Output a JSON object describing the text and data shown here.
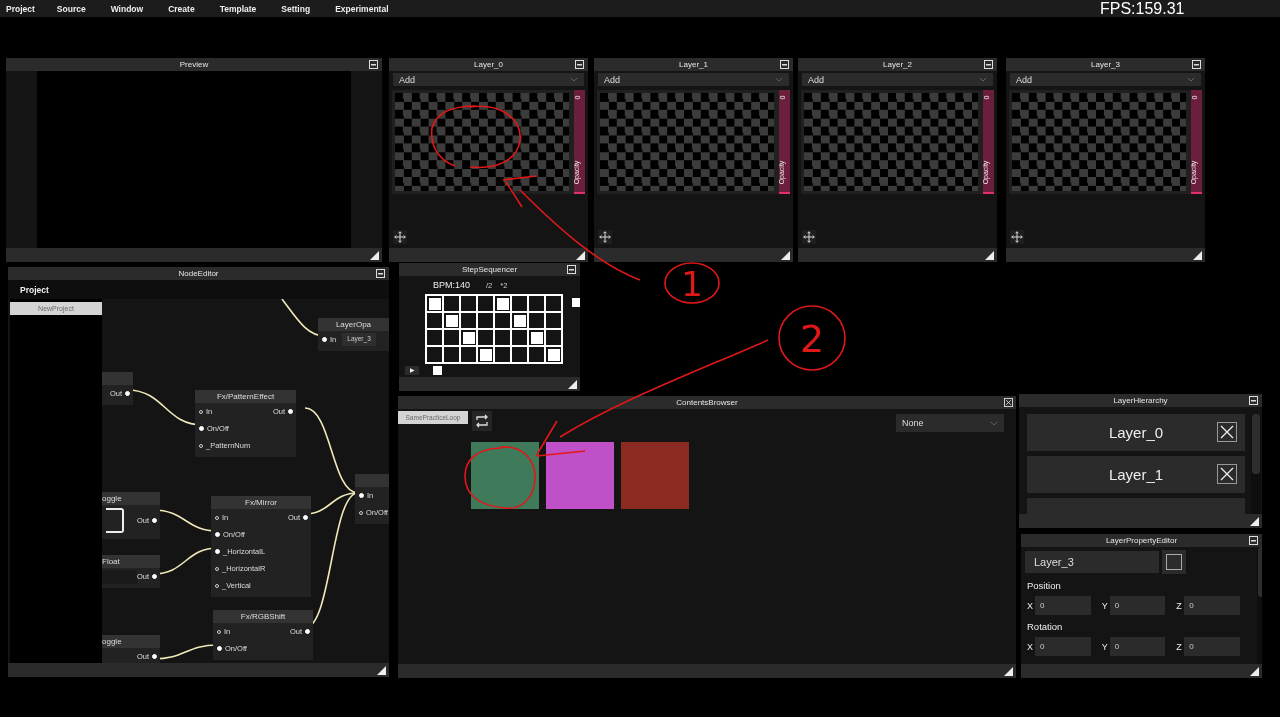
{
  "menu": [
    "Project",
    "Source",
    "Window",
    "Create",
    "Template",
    "Setting",
    "Experimental"
  ],
  "fps": "FPS:159.31",
  "preview": {
    "title": "Preview"
  },
  "layers": [
    {
      "title": "Layer_0",
      "blend": "Add",
      "opacity_value": "0",
      "opacity_label": "Opacity",
      "level": 0
    },
    {
      "title": "Layer_1",
      "blend": "Add",
      "opacity_value": "0",
      "opacity_label": "Opacity",
      "level": 0
    },
    {
      "title": "Layer_2",
      "blend": "Add",
      "opacity_value": "0",
      "opacity_label": "Opacity",
      "level": 0
    },
    {
      "title": "Layer_3",
      "blend": "Add",
      "opacity_value": "0",
      "opacity_label": "Opacity",
      "level": 0
    }
  ],
  "node_editor": {
    "title": "NodeEditor",
    "header": "Project",
    "projects": [
      {
        "label": "NewProject",
        "selected": true
      }
    ],
    "nodes": [
      {
        "rows": [
          {
            "right": {
              "label": "Out",
              "connected": true
            }
          }
        ]
      },
      {
        "title": "LayerOpa",
        "rows": [
          {
            "left": {
              "label": "In",
              "connected": true
            },
            "widget": {
              "kind": "field",
              "value": "Layer_3"
            }
          }
        ]
      },
      {
        "title": "Fx/PatternEffect",
        "rows": [
          {
            "left": {
              "label": "In",
              "connected": false
            },
            "right": {
              "label": "Out",
              "connected": true
            }
          },
          {
            "left": {
              "label": "On/Off",
              "connected": true
            }
          },
          {
            "left": {
              "label": "_PatternNum",
              "connected": false
            }
          }
        ]
      },
      {
        "title": "oggle",
        "rows": [
          {
            "widget": {
              "kind": "toggle",
              "on": false
            },
            "right": {
              "label": "Out",
              "connected": true
            }
          }
        ]
      },
      {
        "title": "Fx/Mirror",
        "rows": [
          {
            "left": {
              "label": "In",
              "connected": false
            },
            "right": {
              "label": "Out",
              "connected": true
            }
          },
          {
            "left": {
              "label": "On/Off",
              "connected": true
            }
          },
          {
            "left": {
              "label": "_HorizontalL",
              "connected": true
            }
          },
          {
            "left": {
              "label": "_HorizontalR",
              "connected": false
            }
          },
          {
            "left": {
              "label": "_Vertical",
              "connected": false
            }
          }
        ]
      },
      {
        "title": "Float",
        "rows": [
          {
            "widget": {
              "kind": "field"
            },
            "right": {
              "label": "Out",
              "connected": true
            }
          }
        ]
      },
      {
        "title": "Fx/RGBShift",
        "rows": [
          {
            "left": {
              "label": "In",
              "connected": false
            },
            "right": {
              "label": "Out",
              "connected": true
            }
          },
          {
            "left": {
              "label": "On/Off",
              "connected": true
            }
          }
        ]
      },
      {
        "title": "oggle",
        "rows": [
          {
            "right": {
              "label": "Out",
              "connected": true
            }
          }
        ]
      },
      {
        "rows": [
          {
            "left": {
              "label": "In",
              "connected": true
            }
          },
          {
            "left": {
              "label": "On/Off",
              "connected": false
            }
          }
        ]
      }
    ]
  },
  "step_sequencer": {
    "title": "StepSequencer",
    "bpm": "BPM:140",
    "half": "/2",
    "double": "*2",
    "play": "▶",
    "steps": [
      [
        true,
        false,
        false,
        false,
        true,
        false,
        false,
        false
      ],
      [
        false,
        true,
        false,
        false,
        false,
        true,
        false,
        false
      ],
      [
        false,
        false,
        true,
        false,
        false,
        false,
        true,
        false
      ],
      [
        false,
        false,
        false,
        true,
        false,
        false,
        false,
        true
      ]
    ]
  },
  "contents_browser": {
    "title": "ContentsBrowser",
    "tabs": [
      {
        "label": "SamePracticeLoop",
        "selected": true
      }
    ],
    "filter": "None"
  },
  "layer_hierarchy": {
    "title": "LayerHierarchy",
    "rows": [
      {
        "label": "Layer_0"
      },
      {
        "label": "Layer_1"
      }
    ]
  },
  "layer_property_editor": {
    "title": "LayerPropertyEditor",
    "name": "Layer_3",
    "checked": false,
    "sections": [
      {
        "label": "Position",
        "fields": [
          {
            "axis": "X",
            "value": "0"
          },
          {
            "axis": "Y",
            "value": "0"
          },
          {
            "axis": "Z",
            "value": "0"
          }
        ]
      },
      {
        "label": "Rotation",
        "fields": [
          {
            "axis": "X",
            "value": "0"
          },
          {
            "axis": "Y",
            "value": "0"
          },
          {
            "axis": "Z",
            "value": "0"
          }
        ]
      }
    ]
  },
  "annotations": [
    {
      "label": "1"
    },
    {
      "label": "2"
    }
  ]
}
